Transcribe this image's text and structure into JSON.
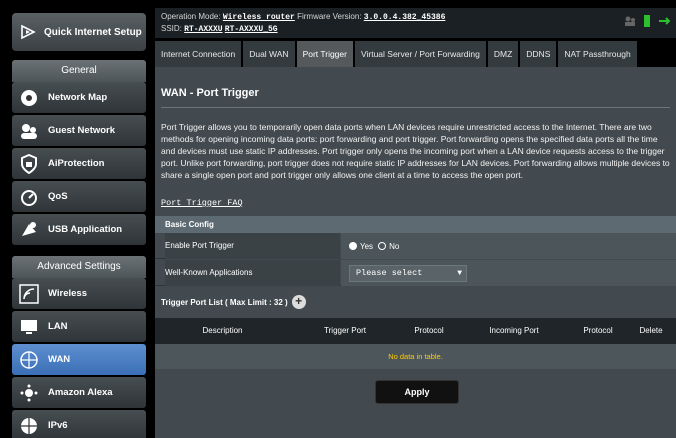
{
  "sidebar": {
    "quick_setup": "Quick Internet Setup",
    "general_header": "General",
    "general_items": [
      {
        "label": "Network Map",
        "icon": "network-map-icon"
      },
      {
        "label": "Guest Network",
        "icon": "guest-network-icon"
      },
      {
        "label": "AiProtection",
        "icon": "shield-icon"
      },
      {
        "label": "QoS",
        "icon": "gauge-icon"
      },
      {
        "label": "USB Application",
        "icon": "puzzle-icon"
      }
    ],
    "advanced_header": "Advanced Settings",
    "advanced_items": [
      {
        "label": "Wireless",
        "icon": "wifi-icon"
      },
      {
        "label": "LAN",
        "icon": "monitor-icon"
      },
      {
        "label": "WAN",
        "icon": "globe-icon",
        "active": true
      },
      {
        "label": "Amazon Alexa",
        "icon": "alexa-icon"
      },
      {
        "label": "IPv6",
        "icon": "ipv6-globe-icon"
      }
    ]
  },
  "top": {
    "mode_label": "Operation Mode:",
    "mode_value": "Wireless router",
    "fw_label": "Firmware Version:",
    "fw_value": "3.0.0.4.382_45386",
    "ssid_label": "SSID:",
    "ssid_1": "RT-AXXXU",
    "ssid_2": "RT-AXXXU_5G"
  },
  "tabs": [
    "Internet Connection",
    "Dual WAN",
    "Port Trigger",
    "Virtual Server / Port Forwarding",
    "DMZ",
    "DDNS",
    "NAT Passthrough"
  ],
  "page": {
    "title": "WAN - Port Trigger",
    "description": "Port Trigger allows you to temporarily open data ports when LAN devices require unrestricted access to the Internet. There are two methods for opening incoming data ports: port forwarding and port trigger. Port forwarding opens the specified data ports all the time and devices must use static IP addresses. Port trigger only opens the incoming port when a LAN device requests access to the trigger port. Unlike port forwarding, port trigger does not require static IP addresses for LAN devices. Port forwarding allows multiple devices to share a single open port and port trigger only allows one client at a time to access the open port.",
    "faq_link": "Port Trigger FAQ"
  },
  "basic_config": {
    "header": "Basic Config",
    "enable_label": "Enable Port Trigger",
    "yes": "Yes",
    "no": "No",
    "wellknown_label": "Well-Known Applications",
    "wellknown_value": "Please select"
  },
  "trigger_list": {
    "title": "Trigger Port List ( Max Limit : 32 )",
    "columns": [
      "Description",
      "Trigger Port",
      "Protocol",
      "Incoming Port",
      "Protocol",
      "Delete"
    ],
    "empty": "No data in table."
  },
  "apply_label": "Apply",
  "colors": {
    "active_nav": "#3b6fb6",
    "empty_text": "#ffcc00",
    "panel": "#424a4f"
  }
}
